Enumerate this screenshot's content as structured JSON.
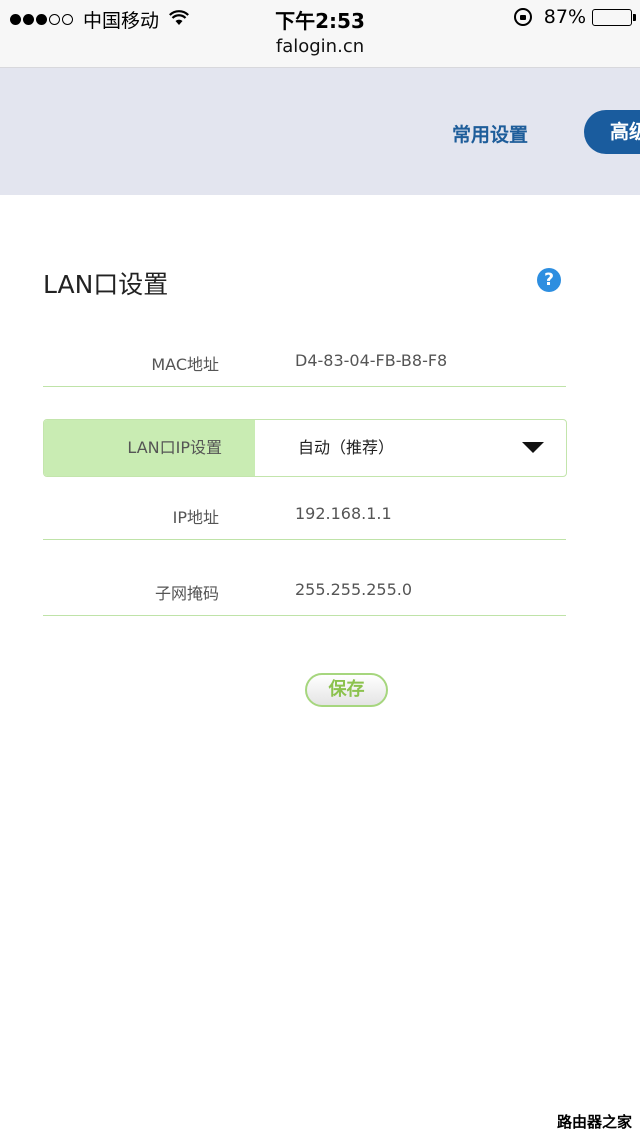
{
  "status_bar": {
    "carrier": "中国移动",
    "time": "下午2:53",
    "url": "falogin.cn",
    "battery": "87%",
    "battery_level": 0.87
  },
  "nav": {
    "common_label": "常用设置",
    "advanced_label": "高级"
  },
  "page": {
    "title": "LAN口设置",
    "help_glyph": "?"
  },
  "fields": {
    "mac_label": "MAC地址",
    "mac_value": "D4-83-04-FB-B8-F8",
    "lan_ip_label": "LAN口IP设置",
    "lan_ip_value": "自动（推荐）",
    "ip_label": "IP地址",
    "ip_value": "192.168.1.1",
    "mask_label": "子网掩码",
    "mask_value": "255.255.255.0"
  },
  "actions": {
    "save_label": "保存"
  },
  "watermark": {
    "text": "路由器之家"
  },
  "colors": {
    "accent_blue": "#1a5c9e",
    "label_green": "#c9ecb3",
    "save_green": "#8cc24e",
    "help_blue": "#2d8ee0"
  }
}
